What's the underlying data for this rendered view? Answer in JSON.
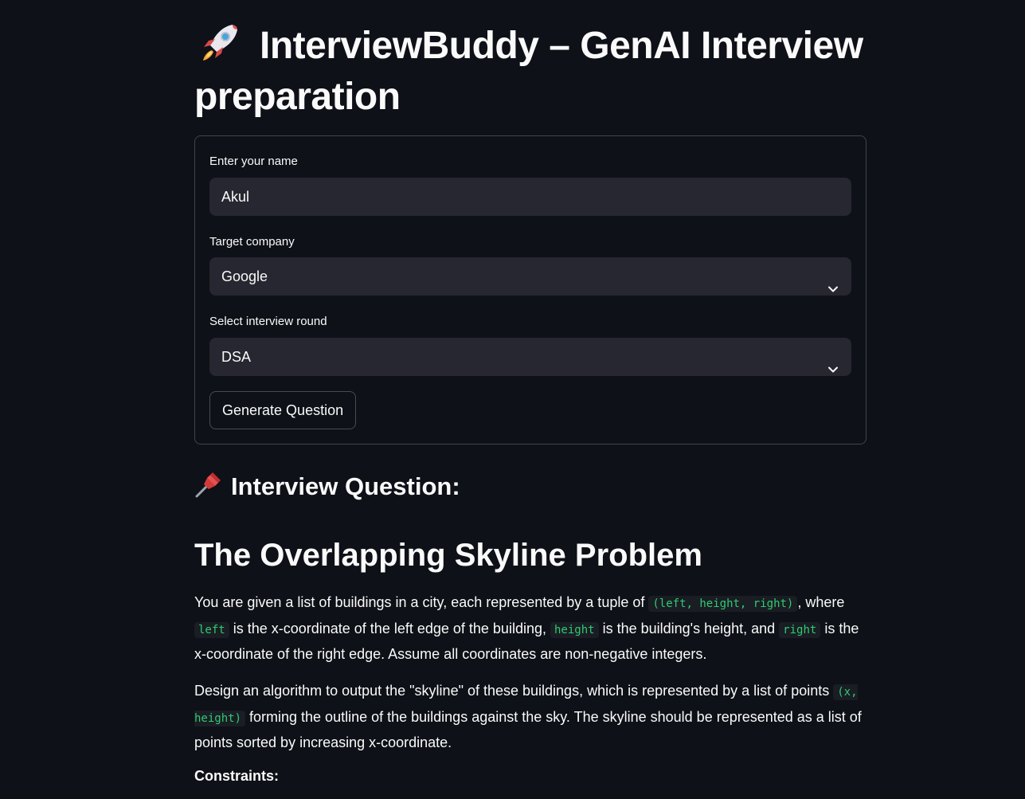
{
  "header": {
    "title": "InterviewBuddy – GenAI Interview preparation",
    "icon": "rocket-icon"
  },
  "form": {
    "name_label": "Enter your name",
    "name_value": "Akul",
    "company_label": "Target company",
    "company_value": "Google",
    "round_label": "Select interview round",
    "round_value": "DSA",
    "generate_button": "Generate Question"
  },
  "question": {
    "header": "Interview Question:",
    "header_icon": "pushpin-icon",
    "title": "The Overlapping Skyline Problem",
    "p1": {
      "t1": "You are given a list of buildings in a city, each represented by a tuple of ",
      "c1": "(left, height, right)",
      "t2": ", where ",
      "c2": "left",
      "t3": " is the x-coordinate of the left edge of the building, ",
      "c3": "height",
      "t4": " is the building's height, and ",
      "c4": "right",
      "t5": " is the x-coordinate of the right edge. Assume all coordinates are non-negative integers."
    },
    "p2": {
      "t1": "Design an algorithm to output the \"skyline\" of these buildings, which is represented by a list of points ",
      "c1": "(x, height)",
      "t2": " forming the outline of the buildings against the sky. The skyline should be represented as a list of points sorted by increasing x-coordinate."
    },
    "constraints_label": "Constraints:"
  },
  "colors": {
    "background": "#0e1117",
    "input_bg": "#262730",
    "text": "#fafafa",
    "code_text": "#2ecc71"
  }
}
